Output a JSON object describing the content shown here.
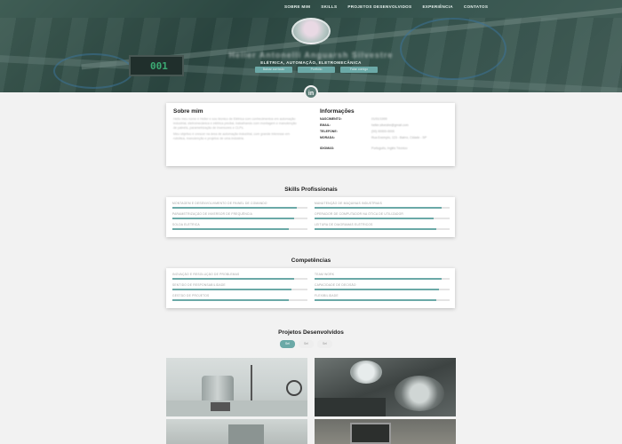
{
  "nav": {
    "items": [
      "SOBRE MIM",
      "SKILLS",
      "PROJETOS DESENVOLVIDOS",
      "EXPERIÊNCIA",
      "CONTATOS"
    ]
  },
  "hero": {
    "name": "Heller Antonelli Anguarsh Silvestre",
    "subtitle": "ELÉTRICA, AUTOMAÇÃO, ELETROMECÂNICA",
    "buttons": [
      "Baixar currículo",
      "Portfólio",
      "Falar comigo"
    ],
    "display_digits": "001"
  },
  "linkedin": {
    "label": "in"
  },
  "about": {
    "title": "Sobre mim",
    "paragraph1": "Hello meu nome é Heller e sou técnico de Elétrica com conhecimentos em automação industrial, eletromecânica e elétrica predial, trabalhando com montagem e manutenção de painéis, parametrização de inversores e CLPs.",
    "paragraph2": "Meu objetivo é crescer na área de automação industrial, com grande interesse em robótica, manutenção e projetos de uma indústria."
  },
  "info": {
    "title": "Informações",
    "rows": [
      {
        "k": "NASCIMENTO:",
        "v": "01/01/1999"
      },
      {
        "k": "EMAIL:",
        "v": "heller.silvestre@gmail.com"
      },
      {
        "k": "TELEFONE:",
        "v": "(00) 00000-0000"
      },
      {
        "k": "MORADA:",
        "v": "Rua Exemplo, 123 - Bairro, Cidade - SP"
      },
      {
        "k": "IDIOMAS:",
        "v": "Português, Inglês Técnico"
      }
    ]
  },
  "skills": {
    "title": "Skills Profissionais",
    "items": [
      {
        "label": "MONTAGEM E DESENVOLVIMENTO DE PAINEL DE COMANDO",
        "level": 0.92
      },
      {
        "label": "MANUTENÇÃO DE MÁQUINAS INDUSTRIAIS",
        "level": 0.94
      },
      {
        "label": "PARAMETRIZAÇÃO DE INVERSOR DE FREQUÊNCIA",
        "level": 0.9
      },
      {
        "label": "OPERADOR DE COMPUTADOR NA ÓTICA DE UTILIZADOR",
        "level": 0.88
      },
      {
        "label": "SOLDA ELÉTRICA",
        "level": 0.86
      },
      {
        "label": "LEITURA DE DIAGRAMAS ELÉTRICOS",
        "level": 0.9
      }
    ]
  },
  "competencias": {
    "title": "Competências",
    "items": [
      {
        "label": "INOVAÇÃO E RESOLUÇÃO DE PROBLEMAS",
        "level": 0.9
      },
      {
        "label": "TEAM WORK",
        "level": 0.94
      },
      {
        "label": "SENTIDO DE RESPONSABILIDADE",
        "level": 0.88
      },
      {
        "label": "CAPACIDADE DE DECISÃO",
        "level": 0.92
      },
      {
        "label": "GESTÃO DE PROJETOS",
        "level": 0.86
      },
      {
        "label": "FLEXIBILIDADE",
        "level": 0.9
      }
    ]
  },
  "projects": {
    "title": "Projetos Desenvolvidos",
    "filters": [
      "Sel",
      "Sel",
      "Sel"
    ]
  },
  "colors": {
    "accent": "#6ba9a7",
    "hero": "#3f5f58",
    "background": "#f2f2f2"
  }
}
